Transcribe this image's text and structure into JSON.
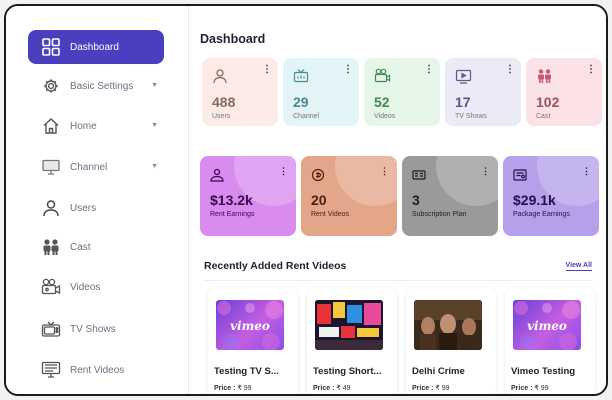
{
  "sidebar": {
    "items": [
      {
        "label": "Dashboard",
        "icon": "dashboard-grid-icon",
        "active": true,
        "has_chevron": false
      },
      {
        "label": "Basic Settings",
        "icon": "gear-icon",
        "active": false,
        "has_chevron": true
      },
      {
        "label": "Home",
        "icon": "home-icon",
        "active": false,
        "has_chevron": true
      },
      {
        "label": "Channel",
        "icon": "monitor-icon",
        "active": false,
        "has_chevron": true
      },
      {
        "label": "Users",
        "icon": "user-icon",
        "active": false,
        "has_chevron": false
      },
      {
        "label": "Cast",
        "icon": "cast-people-icon",
        "active": false,
        "has_chevron": false
      },
      {
        "label": "Videos",
        "icon": "video-camera-icon",
        "active": false,
        "has_chevron": false
      },
      {
        "label": "TV Shows",
        "icon": "tv-icon",
        "active": false,
        "has_chevron": false
      },
      {
        "label": "Rent Videos",
        "icon": "rent-monitor-icon",
        "active": false,
        "has_chevron": false
      }
    ]
  },
  "main": {
    "title": "Dashboard",
    "stats": [
      {
        "value": "488",
        "label": "Users",
        "icon": "user-icon",
        "bg": "#fbeae6",
        "color": "#8a6b5e"
      },
      {
        "value": "29",
        "label": "Channel",
        "icon": "antenna-tv-icon",
        "bg": "#e3f4f7",
        "color": "#4a8a94"
      },
      {
        "value": "52",
        "label": "Videos",
        "icon": "video-camera-icon",
        "bg": "#e5f5e8",
        "color": "#3f8a4e"
      },
      {
        "value": "17",
        "label": "TV Shows",
        "icon": "tv-icon",
        "bg": "#eceaf6",
        "color": "#5a5a8a"
      },
      {
        "value": "102",
        "label": "Cast",
        "icon": "cast-people-icon",
        "bg": "#fbe2e6",
        "color": "#a0505e"
      }
    ],
    "big_stats": [
      {
        "value": "$13.2k",
        "label": "Rent Earnings",
        "icon": "wallet-icon",
        "bg": "#d98bf0",
        "color": "#3a0a4a"
      },
      {
        "value": "20",
        "label": "Rent Videos",
        "icon": "rent-coin-icon",
        "bg": "#e4a689",
        "color": "#4a2010"
      },
      {
        "value": "3",
        "label": "Subscription Plan",
        "icon": "plan-icon",
        "bg": "#9a9a9a",
        "color": "#1e1e1e"
      },
      {
        "value": "$29.1k",
        "label": "Package Earnings",
        "icon": "package-icon",
        "bg": "#b5a0ea",
        "color": "#24104a"
      }
    ],
    "section_title": "Recently Added Rent Videos",
    "view_all": "View All",
    "videos": [
      {
        "title": "Testing TV S...",
        "price_label": "Price :",
        "price": "₹ 99",
        "thumb": "vimeo",
        "thumb_text": "vimeo"
      },
      {
        "title": "Testing Short...",
        "price_label": "Price :",
        "price": "₹ 49",
        "thumb": "city",
        "thumb_text": ""
      },
      {
        "title": "Delhi Crime",
        "price_label": "Price :",
        "price": "₹ 99",
        "thumb": "crime",
        "thumb_text": ""
      },
      {
        "title": "Vimeo Testing",
        "price_label": "Price :",
        "price": "₹ 99",
        "thumb": "vimeo",
        "thumb_text": "vimeo"
      }
    ]
  },
  "colors": {
    "accent": "#4a3fbf"
  }
}
